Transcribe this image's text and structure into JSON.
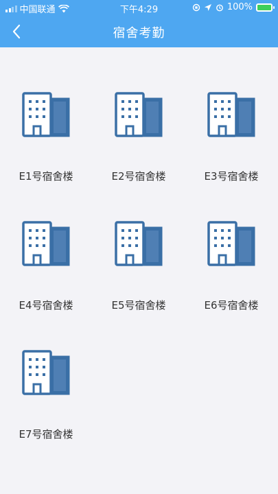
{
  "status_bar": {
    "carrier": "中国联通",
    "time": "下午4:29",
    "battery": "100%"
  },
  "header": {
    "title": "宿舍考勤",
    "back_icon": "chevron-left-icon"
  },
  "buildings": [
    {
      "label": "E1号宿舍楼",
      "icon": "building-icon"
    },
    {
      "label": "E2号宿舍楼",
      "icon": "building-icon"
    },
    {
      "label": "E3号宿舍楼",
      "icon": "building-icon"
    },
    {
      "label": "E4号宿舍楼",
      "icon": "building-icon"
    },
    {
      "label": "E5号宿舍楼",
      "icon": "building-icon"
    },
    {
      "label": "E6号宿舍楼",
      "icon": "building-icon"
    },
    {
      "label": "E7号宿舍楼",
      "icon": "building-icon"
    }
  ],
  "colors": {
    "header_bg": "#4ea7f1",
    "icon_stroke": "#3a6fa6",
    "icon_fill": "#3a6fa6",
    "page_bg": "#f3f3f7"
  }
}
